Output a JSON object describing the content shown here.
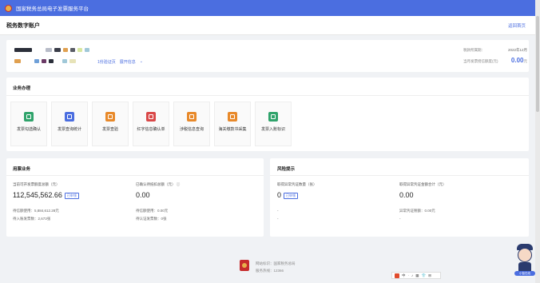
{
  "platform": {
    "title": "国家税务总局电子发票服务平台"
  },
  "page": {
    "title": "税务数字账户",
    "back_link": "返回首页"
  },
  "account": {
    "links": [
      "1份验证页",
      "展开信息"
    ],
    "tax_period_label": "税款所属期：",
    "tax_period_value": "2022年12月",
    "credit_label": "当月发票授信额度(元)",
    "credit_value": "0.00",
    "credit_unit": "元"
  },
  "business": {
    "title": "业务办理",
    "items": [
      {
        "label": "发票勾选确认",
        "color": "#2fa36b",
        "icon": "check-square-icon"
      },
      {
        "label": "发票查询统计",
        "color": "#4b6ee0",
        "icon": "search-doc-icon"
      },
      {
        "label": "发票查验",
        "color": "#e8892a",
        "icon": "verify-icon"
      },
      {
        "label": "红字信息确认单",
        "color": "#d94848",
        "icon": "red-doc-icon"
      },
      {
        "label": "涉税信息查询",
        "color": "#e8892a",
        "icon": "info-search-icon"
      },
      {
        "label": "海关缴款书采集",
        "color": "#e8892a",
        "icon": "customs-icon"
      },
      {
        "label": "发票入账标识",
        "color": "#2fa36b",
        "icon": "ledger-icon"
      }
    ]
  },
  "invoice": {
    "title": "用票业务",
    "left_label": "当前可开发票额度总额（元）",
    "left_value": "112,545,562.66",
    "left_tag": "已申领",
    "left_sub1_label": "待信额使用：",
    "left_sub1_value": "5,884,612.28元",
    "left_sub2_label": "待入账发票数：",
    "left_sub2_value": "2,673张",
    "right_label": "已确认待抵扣总额（元）",
    "right_value": "0.00",
    "right_sub1_label": "待信额使用：",
    "right_sub1_value": "0.00元",
    "right_sub2_label": "待认证发票数：",
    "right_sub2_value": "0张"
  },
  "risk": {
    "title": "风险提示",
    "left_label": "取得异常凭证数量（张）",
    "left_value": "0",
    "left_tag": "已申领",
    "left_sub": "-",
    "left_sub2": "-",
    "right_label": "取得异常凭证金额合计（元）",
    "right_value": "0.00",
    "right_sub": "异常凭证税额：0.00元",
    "right_sub2": "-"
  },
  "footer": {
    "line1": "网站标识：国家税务总局",
    "line2": "服务热线：12366"
  },
  "toolbar": {
    "items": [
      "中",
      "·",
      "♪",
      "▦",
      "👕",
      "⊞"
    ]
  },
  "assistant": {
    "label": "小智在线"
  }
}
